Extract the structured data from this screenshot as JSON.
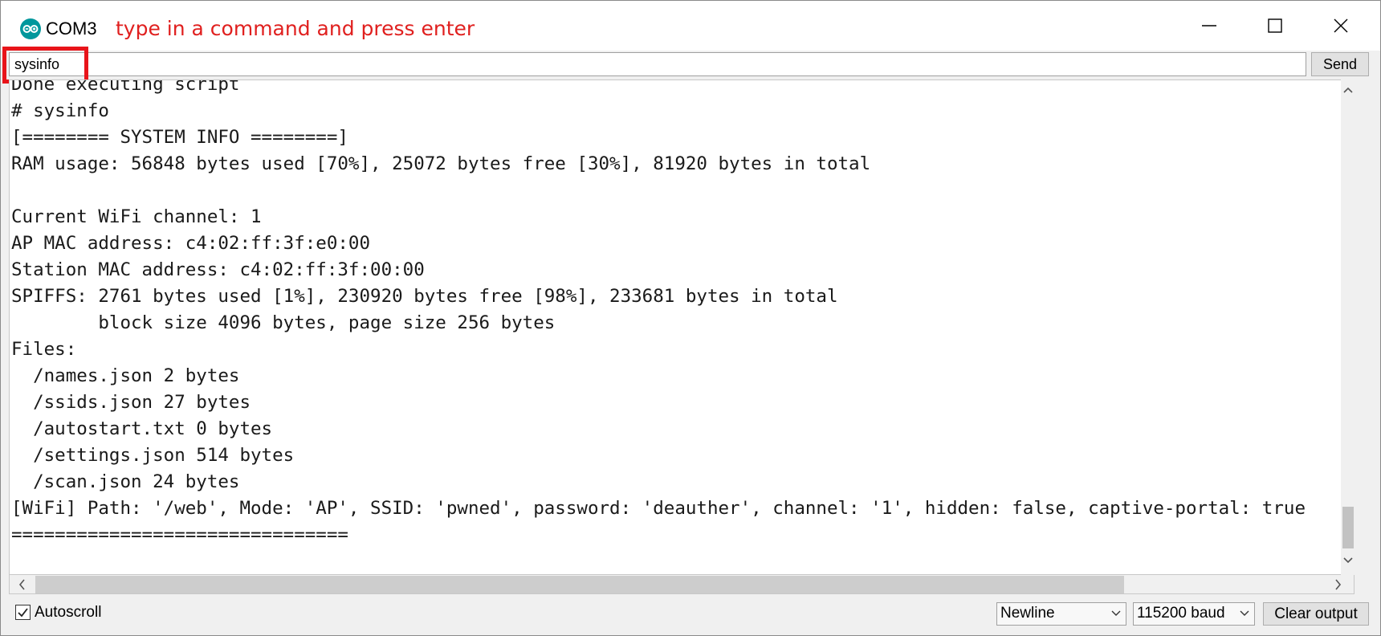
{
  "window": {
    "title": "COM3",
    "annotation": "type in a command and press enter"
  },
  "command": {
    "value": "sysinfo",
    "send_label": "Send"
  },
  "output": {
    "lines": [
      "Done executing script",
      "# sysinfo",
      "[======== SYSTEM INFO ========]",
      "RAM usage: 56848 bytes used [70%], 25072 bytes free [30%], 81920 bytes in total",
      "",
      "Current WiFi channel: 1",
      "AP MAC address: c4:02:ff:3f:e0:00",
      "Station MAC address: c4:02:ff:3f:00:00",
      "SPIFFS: 2761 bytes used [1%], 230920 bytes free [98%], 233681 bytes in total",
      "        block size 4096 bytes, page size 256 bytes",
      "Files:",
      "  /names.json 2 bytes",
      "  /ssids.json 27 bytes",
      "  /autostart.txt 0 bytes",
      "  /settings.json 514 bytes",
      "  /scan.json 24 bytes",
      "[WiFi] Path: '/web', Mode: 'AP', SSID: 'pwned', password: 'deauther', channel: '1', hidden: false, captive-portal: true",
      "==============================="
    ]
  },
  "footer": {
    "autoscroll_label": "Autoscroll",
    "autoscroll_checked": true,
    "line_ending": "Newline",
    "baud_rate": "115200 baud",
    "clear_label": "Clear output"
  },
  "colors": {
    "accent_icon": "#00979c",
    "annotation": "#e0201f",
    "highlight_box": "#e8141a"
  }
}
